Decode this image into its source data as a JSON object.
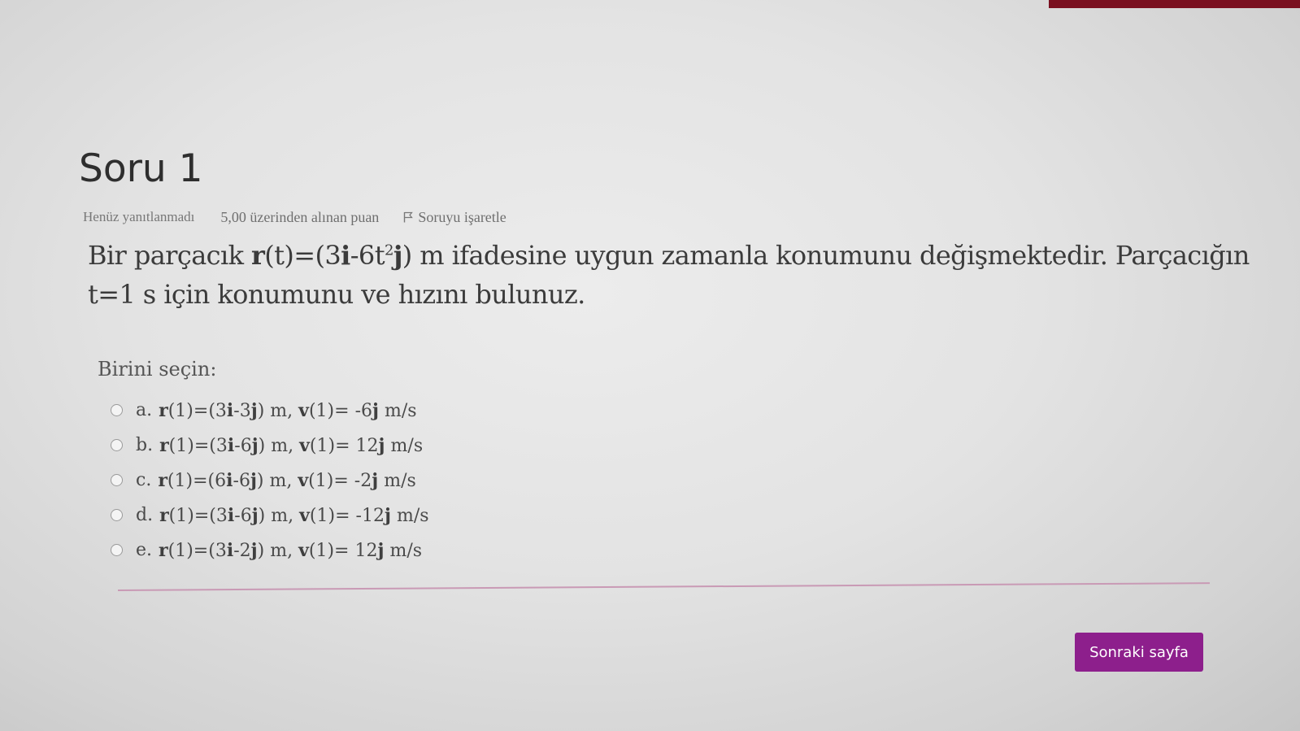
{
  "question": {
    "title": "Soru 1",
    "state": "Henüz yanıtlanmadı",
    "grade": "5,00 üzerinden alınan puan",
    "flag_label": "Soruyu işaretle",
    "text": {
      "part1": "Bir parçacık ",
      "r_symbol": "r",
      "part2": "(t)=(3",
      "i_symbol": "i",
      "part3": "-6t",
      "exponent": "2",
      "j_symbol": "j",
      "part4": ") m ifadesine uygun zamanla konumunu değişmektedir. Parçacığın t=1 s için konumunu ve hızını bulunuz."
    },
    "prompt": "Birini seçin:",
    "options": [
      {
        "letter": "a.",
        "text": "r(1)=(3i-3j) m, v(1)= -6j m/s"
      },
      {
        "letter": "b.",
        "text": "r(1)=(3i-6j) m, v(1)= 12j m/s"
      },
      {
        "letter": "c.",
        "text": "r(1)=(6i-6j) m, v(1)= -2j m/s"
      },
      {
        "letter": "d.",
        "text": "r(1)=(3i-6j) m, v(1)= -12j m/s"
      },
      {
        "letter": "e.",
        "text": "r(1)=(3i-2j) m, v(1)= 12j m/s"
      }
    ]
  },
  "navigation": {
    "next_label": "Sonraki sayfa"
  },
  "colors": {
    "accent": "#8d1f8c",
    "top_bar": "#7a1020",
    "divider": "#c99ab5"
  },
  "icons": {
    "flag": "flag-icon",
    "radio": "radio-icon"
  }
}
